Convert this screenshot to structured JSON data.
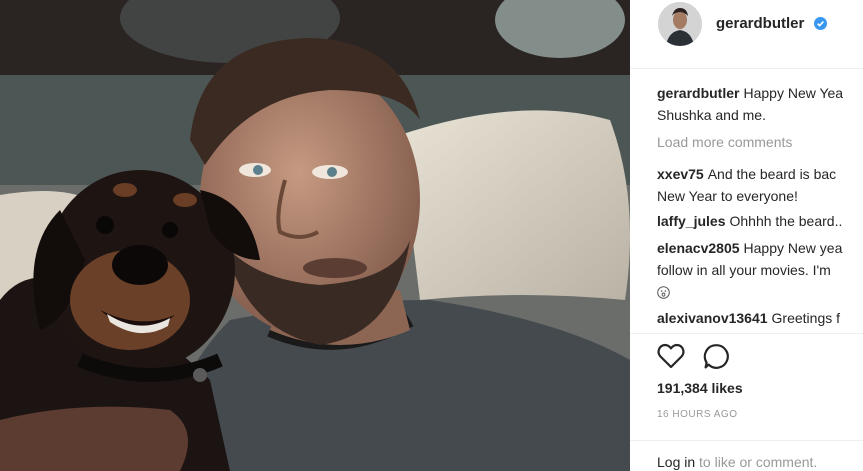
{
  "post": {
    "username": "gerardbutler",
    "verified": true,
    "caption": {
      "user": "gerardbutler",
      "line1": "Happy New Yea",
      "line2": "Shushka and me."
    },
    "load_more": "Load more comments",
    "comments": [
      {
        "user": "xxev75",
        "line1": "And the beard is bac",
        "line2": "New Year to everyone!"
      },
      {
        "user": "laffy_jules",
        "line1": "Ohhhh the beard.."
      },
      {
        "user": "elenacv2805",
        "line1": "Happy New yea",
        "line2": "follow in all your movies. I'm"
      },
      {
        "user": "alexivanov13641",
        "line1": "Greetings f"
      }
    ],
    "likes": "191,384 likes",
    "timestamp": "16 HOURS AGO",
    "login_link": "Log in",
    "login_rest": "to like or comment."
  },
  "icons": {
    "verified": "verified-badge-icon",
    "like": "heart-icon",
    "comment": "speech-bubble-icon",
    "emoji": "smiley-icon"
  },
  "colors": {
    "verified_blue": "#3897f0",
    "text": "#262626",
    "muted": "#999999"
  }
}
